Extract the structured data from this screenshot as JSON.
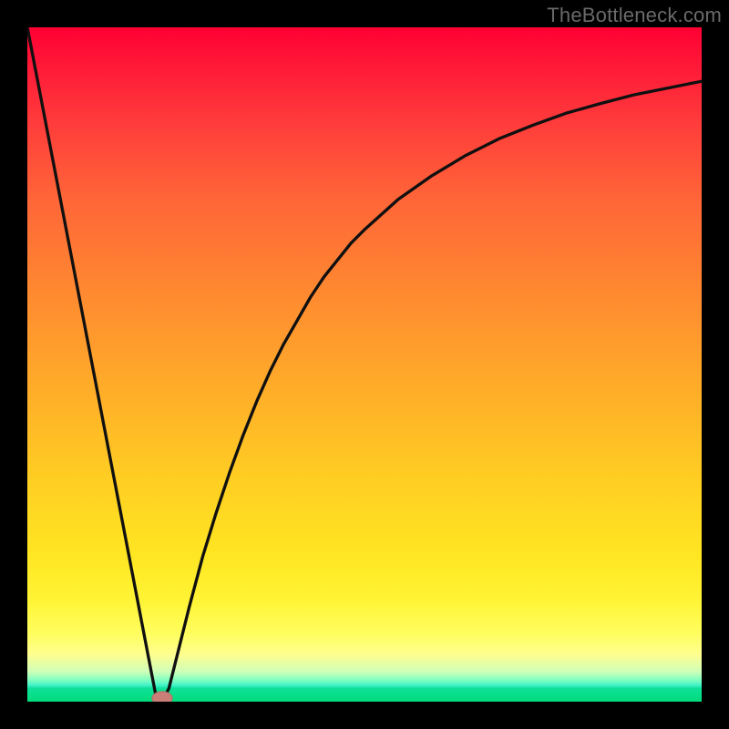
{
  "watermark": "TheBottleneck.com",
  "colors": {
    "frame_bg": "#000000",
    "curve_stroke": "#101010",
    "marker_fill": "#c97f78",
    "marker_stroke": "#b56f66",
    "gradient_top": "#ff0033",
    "gradient_bottom": "#00db7a"
  },
  "chart_data": {
    "type": "line",
    "title": "",
    "xlabel": "",
    "ylabel": "",
    "xlim": [
      0,
      100
    ],
    "ylim": [
      0,
      100
    ],
    "grid": false,
    "x": [
      0,
      2,
      4,
      6,
      8,
      10,
      12,
      14,
      16,
      18,
      19,
      20,
      21,
      22,
      24,
      26,
      28,
      30,
      32,
      34,
      36,
      38,
      40,
      42,
      44,
      46,
      48,
      50,
      55,
      60,
      65,
      70,
      75,
      80,
      85,
      90,
      95,
      100
    ],
    "values": [
      100,
      89.6,
      79.2,
      68.8,
      58.4,
      48.0,
      37.6,
      27.2,
      16.8,
      6.4,
      1.2,
      0.0,
      2.0,
      6.0,
      14.0,
      21.5,
      28.0,
      34.0,
      39.5,
      44.5,
      49.0,
      53.0,
      56.5,
      60.0,
      63.0,
      65.5,
      68.0,
      70.0,
      74.5,
      78.0,
      81.0,
      83.5,
      85.5,
      87.3,
      88.7,
      90.0,
      91.0,
      92.0
    ],
    "marker": {
      "x": 20,
      "y": 0.5,
      "shape": "ellipse",
      "rx": 1.5,
      "ry": 1.0
    },
    "legend": false
  }
}
